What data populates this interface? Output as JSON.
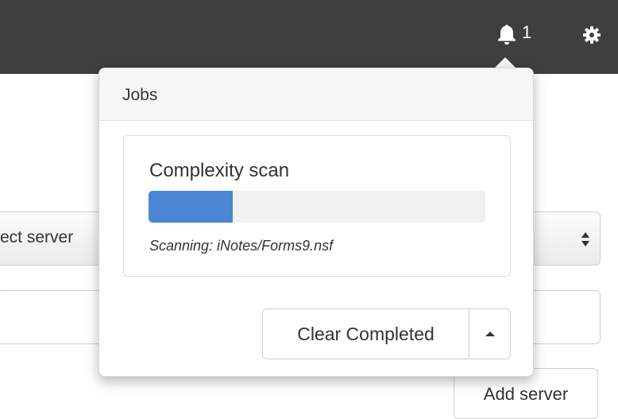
{
  "topbar": {
    "bell_icon": "bell-icon",
    "notification_count": "1",
    "settings_icon": "gear-icon"
  },
  "form": {
    "select_value": "ect server",
    "text_input_value": "",
    "add_server_label": "Add server"
  },
  "jobs_popover": {
    "title": "Jobs",
    "job": {
      "name": "Complexity scan",
      "progress_fraction": 0.25,
      "status": "Scanning: iNotes/Forms9.nsf"
    },
    "clear_label": "Clear Completed",
    "toggle_icon": "caret-up-icon"
  },
  "colors": {
    "topbar": "#3f3f3f",
    "progress": "#4a86d4"
  }
}
